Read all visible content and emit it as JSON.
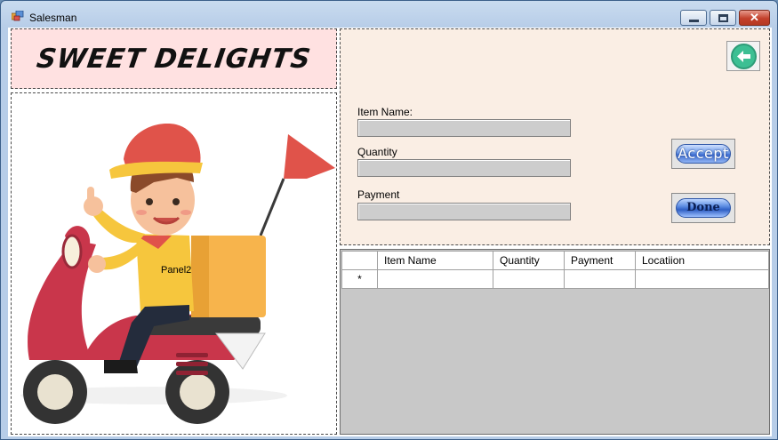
{
  "window": {
    "title": "Salesman",
    "app_icon": "form-app-icon"
  },
  "titlebar_buttons": {
    "minimize": "minimize-icon",
    "maximize": "maximize-icon",
    "close": "close-icon",
    "close_glyph": "✕"
  },
  "header_panel": {
    "brand_text": "SWEET DELIGHTS"
  },
  "image_panel": {
    "label": "Panel2",
    "picture": "delivery-scooter-illustration"
  },
  "form": {
    "item_name_label": "Item Name:",
    "item_name_value": "",
    "quantity_label": "Quantity",
    "quantity_value": "",
    "payment_label": "Payment",
    "payment_value": "",
    "accept_label": "Accept",
    "done_label": "Done",
    "back_icon": "back-arrow-icon"
  },
  "grid": {
    "columns": [
      "Item Name",
      "Quantity",
      "Payment",
      "Locatiion"
    ],
    "new_row_marker": "*",
    "rows": []
  },
  "colors": {
    "header_panel_bg": "#ffe1e1",
    "form_panel_bg": "#faeee4",
    "grid_bg": "#c8c8c8",
    "button_blue": "#3e6dd2",
    "back_button_green": "#3cbf93"
  }
}
